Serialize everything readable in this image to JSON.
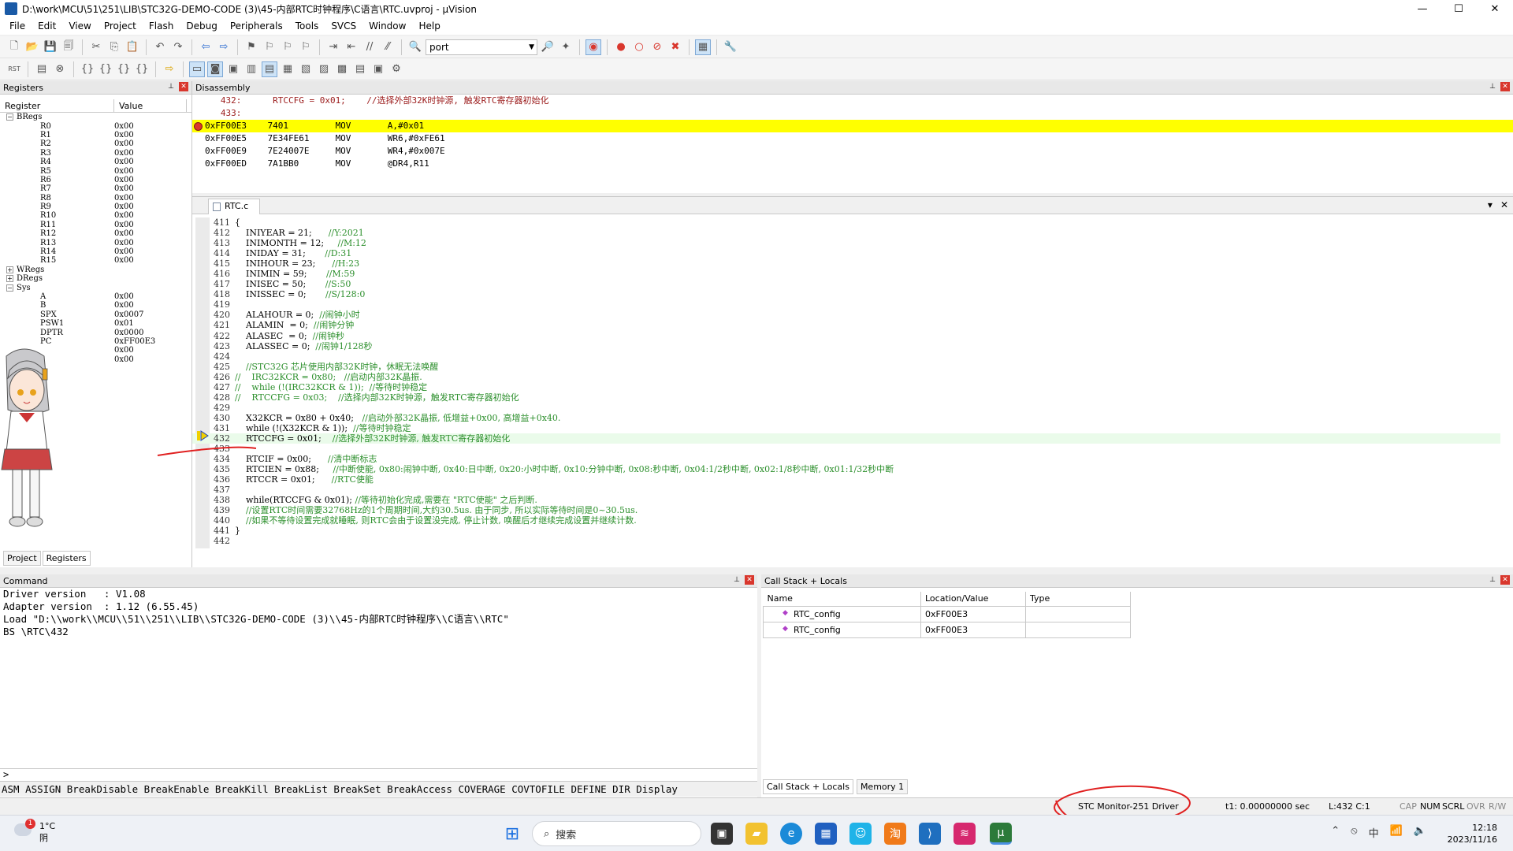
{
  "window": {
    "title": "D:\\work\\MCU\\51\\251\\LIB\\STC32G-DEMO-CODE (3)\\45-内部RTC时钟程序\\C语言\\RTC.uvproj - µVision",
    "min": "—",
    "max": "☐",
    "close": "✕"
  },
  "menu": [
    "File",
    "Edit",
    "View",
    "Project",
    "Flash",
    "Debug",
    "Peripherals",
    "Tools",
    "SVCS",
    "Window",
    "Help"
  ],
  "toolbar": {
    "find_combo": "port"
  },
  "registers": {
    "title": "Registers",
    "col_register": "Register",
    "col_value": "Value",
    "groups": {
      "bregs": "BRegs",
      "wregs": "WRegs",
      "dregs": "DRegs",
      "sys": "Sys"
    },
    "bregs": [
      {
        "n": "R0",
        "v": "0x00"
      },
      {
        "n": "R1",
        "v": "0x00"
      },
      {
        "n": "R2",
        "v": "0x00"
      },
      {
        "n": "R3",
        "v": "0x00"
      },
      {
        "n": "R4",
        "v": "0x00"
      },
      {
        "n": "R5",
        "v": "0x00"
      },
      {
        "n": "R6",
        "v": "0x00"
      },
      {
        "n": "R7",
        "v": "0x00"
      },
      {
        "n": "R8",
        "v": "0x00"
      },
      {
        "n": "R9",
        "v": "0x00"
      },
      {
        "n": "R10",
        "v": "0x00"
      },
      {
        "n": "R11",
        "v": "0x00"
      },
      {
        "n": "R12",
        "v": "0x00"
      },
      {
        "n": "R13",
        "v": "0x00"
      },
      {
        "n": "R14",
        "v": "0x00"
      },
      {
        "n": "R15",
        "v": "0x00"
      }
    ],
    "sys": [
      {
        "n": "A",
        "v": "0x00"
      },
      {
        "n": "B",
        "v": "0x00"
      },
      {
        "n": "SPX",
        "v": "0x0007"
      },
      {
        "n": "PSW1",
        "v": "0x01"
      },
      {
        "n": "DPTR",
        "v": "0x0000"
      },
      {
        "n": "PC",
        "v": "0xFF00E3"
      },
      {
        "n": "",
        "v": "0x00"
      },
      {
        "n": "",
        "v": "0x00"
      }
    ],
    "tab_project": "Project",
    "tab_registers": "Registers"
  },
  "disassembly": {
    "title": "Disassembly",
    "lines": [
      {
        "t": "   432:      RTCCFG = 0x01;    //选择外部32K时钟源, 触发RTC寄存器初始化",
        "kind": "src"
      },
      {
        "t": "   433:",
        "kind": "src"
      },
      {
        "t": "0xFF00E3    7401         MOV       A,#0x01",
        "kind": "hl"
      },
      {
        "t": "0xFF00E5    7E34FE61     MOV       WR6,#0xFE61",
        "kind": "asm"
      },
      {
        "t": "0xFF00E9    7E24007E     MOV       WR4,#0x007E",
        "kind": "asm"
      },
      {
        "t": "0xFF00ED    7A1BB0       MOV       @DR4,R11",
        "kind": "asm"
      }
    ]
  },
  "editor": {
    "tab": "RTC.c",
    "lines": [
      {
        "n": "411",
        "code": "{",
        "cm": ""
      },
      {
        "n": "412",
        "code": "    INIYEAR = 21;      ",
        "cm": "//Y:2021"
      },
      {
        "n": "413",
        "code": "    INIMONTH = 12;     ",
        "cm": "//M:12"
      },
      {
        "n": "414",
        "code": "    INIDAY = 31;       ",
        "cm": "//D:31"
      },
      {
        "n": "415",
        "code": "    INIHOUR = 23;      ",
        "cm": "//H:23"
      },
      {
        "n": "416",
        "code": "    INIMIN = 59;       ",
        "cm": "//M:59"
      },
      {
        "n": "417",
        "code": "    INISEC = 50;       ",
        "cm": "//S:50"
      },
      {
        "n": "418",
        "code": "    INISSEC = 0;       ",
        "cm": "//S/128:0"
      },
      {
        "n": "419",
        "code": "",
        "cm": ""
      },
      {
        "n": "420",
        "code": "    ALAHOUR = 0;  ",
        "cm": "//闹钟小时"
      },
      {
        "n": "421",
        "code": "    ALAMIN  = 0;  ",
        "cm": "//闹钟分钟"
      },
      {
        "n": "422",
        "code": "    ALASEC  = 0;  ",
        "cm": "//闹钟秒"
      },
      {
        "n": "423",
        "code": "    ALASSEC = 0;  ",
        "cm": "//闹钟1/128秒"
      },
      {
        "n": "424",
        "code": "",
        "cm": ""
      },
      {
        "n": "425",
        "code": "    ",
        "cm": "//STC32G 芯片使用内部32K时钟，休眠无法唤醒"
      },
      {
        "n": "426",
        "code": "",
        "cm": "//    IRC32KCR = 0x80;   //启动内部32K晶振."
      },
      {
        "n": "427",
        "code": "",
        "cm": "//    while (!(IRC32KCR & 1));  //等待时钟稳定"
      },
      {
        "n": "428",
        "code": "",
        "cm": "//    RTCCFG = 0x03;    //选择内部32K时钟源，触发RTC寄存器初始化"
      },
      {
        "n": "429",
        "code": "",
        "cm": ""
      },
      {
        "n": "430",
        "code": "    X32KCR = 0x80 + 0x40;   ",
        "cm": "//启动外部32K晶振, 低增益+0x00, 高增益+0x40."
      },
      {
        "n": "431",
        "code": "    while (!(X32KCR & 1));  ",
        "cm": "//等待时钟稳定"
      },
      {
        "n": "432",
        "code": "    RTCCFG = 0x01;    ",
        "cm": "//选择外部32K时钟源, 触发RTC寄存器初始化"
      },
      {
        "n": "433",
        "code": "",
        "cm": ""
      },
      {
        "n": "434",
        "code": "    RTCIF = 0x00;      ",
        "cm": "//清中断标志"
      },
      {
        "n": "435",
        "code": "    RTCIEN = 0x88;     ",
        "cm": "//中断使能, 0x80:闹钟中断, 0x40:日中断, 0x20:小时中断, 0x10:分钟中断, 0x08:秒中断, 0x04:1/2秒中断, 0x02:1/8秒中断, 0x01:1/32秒中断"
      },
      {
        "n": "436",
        "code": "    RTCCR = 0x01;      ",
        "cm": "//RTC使能"
      },
      {
        "n": "437",
        "code": "",
        "cm": ""
      },
      {
        "n": "438",
        "code": "    while(RTCCFG & 0x01); ",
        "cm": "//等待初始化完成,需要在 \"RTC使能\" 之后判断."
      },
      {
        "n": "439",
        "code": "    ",
        "cm": "//设置RTC时间需要32768Hz的1个周期时间,大约30.5us. 由于同步, 所以实际等待时间是0~30.5us."
      },
      {
        "n": "440",
        "code": "    ",
        "cm": "//如果不等待设置完成就睡眠, 则RTC会由于设置没完成, 停止计数, 唤醒后才继续完成设置并继续计数."
      },
      {
        "n": "441",
        "code": "}",
        "cm": ""
      },
      {
        "n": "442",
        "code": "",
        "cm": ""
      }
    ]
  },
  "command": {
    "title": "Command",
    "output": [
      "Driver version   : V1.08",
      "Adapter version  : 1.12 (6.55.45)",
      "Load \"D:\\\\work\\\\MCU\\\\51\\\\251\\\\LIB\\\\STC32G-DEMO-CODE (3)\\\\45-内部RTC时钟程序\\\\C语言\\\\RTC\"",
      "BS \\RTC\\432"
    ],
    "prompt": ">",
    "keywords": "ASM ASSIGN BreakDisable BreakEnable BreakKill BreakList BreakSet BreakAccess COVERAGE COVTOFILE DEFINE DIR Display"
  },
  "callstack": {
    "title": "Call Stack + Locals",
    "col_name": "Name",
    "col_loc": "Location/Value",
    "col_type": "Type",
    "rows": [
      {
        "name": "RTC_config",
        "loc": "0xFF00E3",
        "type": ""
      },
      {
        "name": "RTC_config",
        "loc": "0xFF00E3",
        "type": ""
      }
    ],
    "tab_callstack": "Call Stack + Locals",
    "tab_memory": "Memory 1"
  },
  "status": {
    "driver": "STC Monitor-251 Driver",
    "time": "t1: 0.00000000 sec",
    "pos": "L:432 C:1",
    "caps": "CAP",
    "num": "NUM",
    "scrl": "SCRL",
    "ovr": "OVR",
    "rw": "R/W"
  },
  "taskbar": {
    "weather_temp": "1°C",
    "weather_desc": "阴",
    "weather_badge": "1",
    "search": "搜索",
    "ime": "中",
    "time": "12:18",
    "date": "2023/11/16"
  },
  "colors": {
    "accent": "#1a5aa6",
    "highlight": "#ffff00",
    "comment": "#2c8f2c",
    "keyword": "#1a3fc4",
    "annotation_red": "#e02020"
  }
}
